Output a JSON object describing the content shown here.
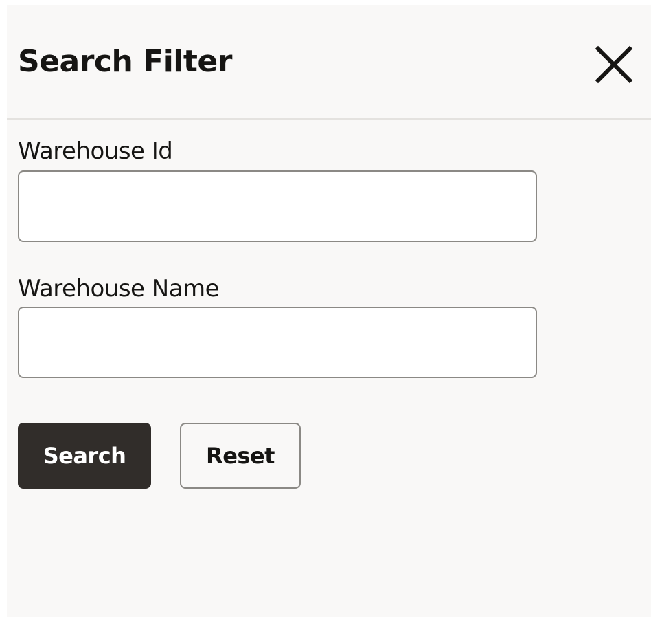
{
  "dialog": {
    "title": "Search Filter",
    "close_icon": "close-icon"
  },
  "fields": {
    "warehouse_id": {
      "label": "Warehouse Id",
      "value": ""
    },
    "warehouse_name": {
      "label": "Warehouse Name",
      "value": ""
    }
  },
  "actions": {
    "search_label": "Search",
    "reset_label": "Reset"
  },
  "colors": {
    "background": "#f9f8f7",
    "primary_button": "#312d2a",
    "text": "#161513",
    "border": "#8b8985"
  }
}
